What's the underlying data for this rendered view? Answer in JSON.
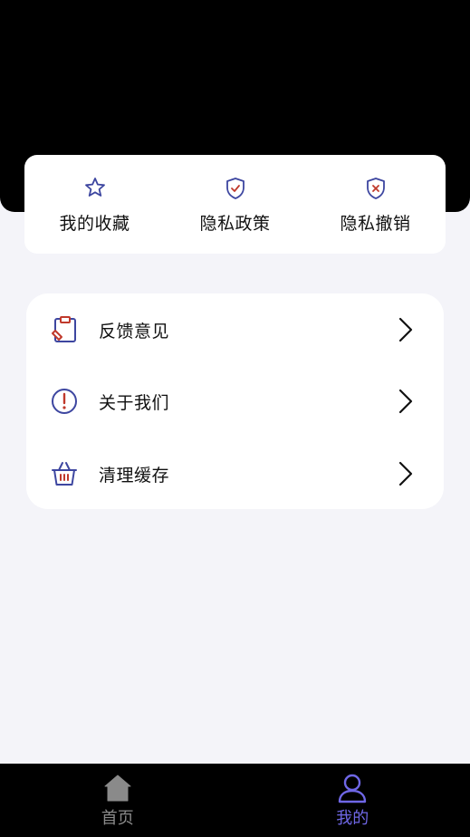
{
  "quick_actions": [
    {
      "label": "我的收藏",
      "icon": "star-icon"
    },
    {
      "label": "隐私政策",
      "icon": "shield-check-icon"
    },
    {
      "label": "隐私撤销",
      "icon": "shield-x-icon"
    }
  ],
  "menu": [
    {
      "label": "反馈意见",
      "icon": "feedback-clipboard-icon"
    },
    {
      "label": "关于我们",
      "icon": "info-exclamation-icon"
    },
    {
      "label": "清理缓存",
      "icon": "basket-icon"
    }
  ],
  "tabs": [
    {
      "label": "首页",
      "icon": "home-icon",
      "active": false
    },
    {
      "label": "我的",
      "icon": "user-icon",
      "active": true
    }
  ],
  "colors": {
    "icon_blue": "#3d46a0",
    "icon_red": "#c0392b",
    "tab_active": "#6f67e6",
    "tab_inactive": "#8a8a8a",
    "header_bg": "#000000",
    "page_bg": "#f4f4f9"
  }
}
